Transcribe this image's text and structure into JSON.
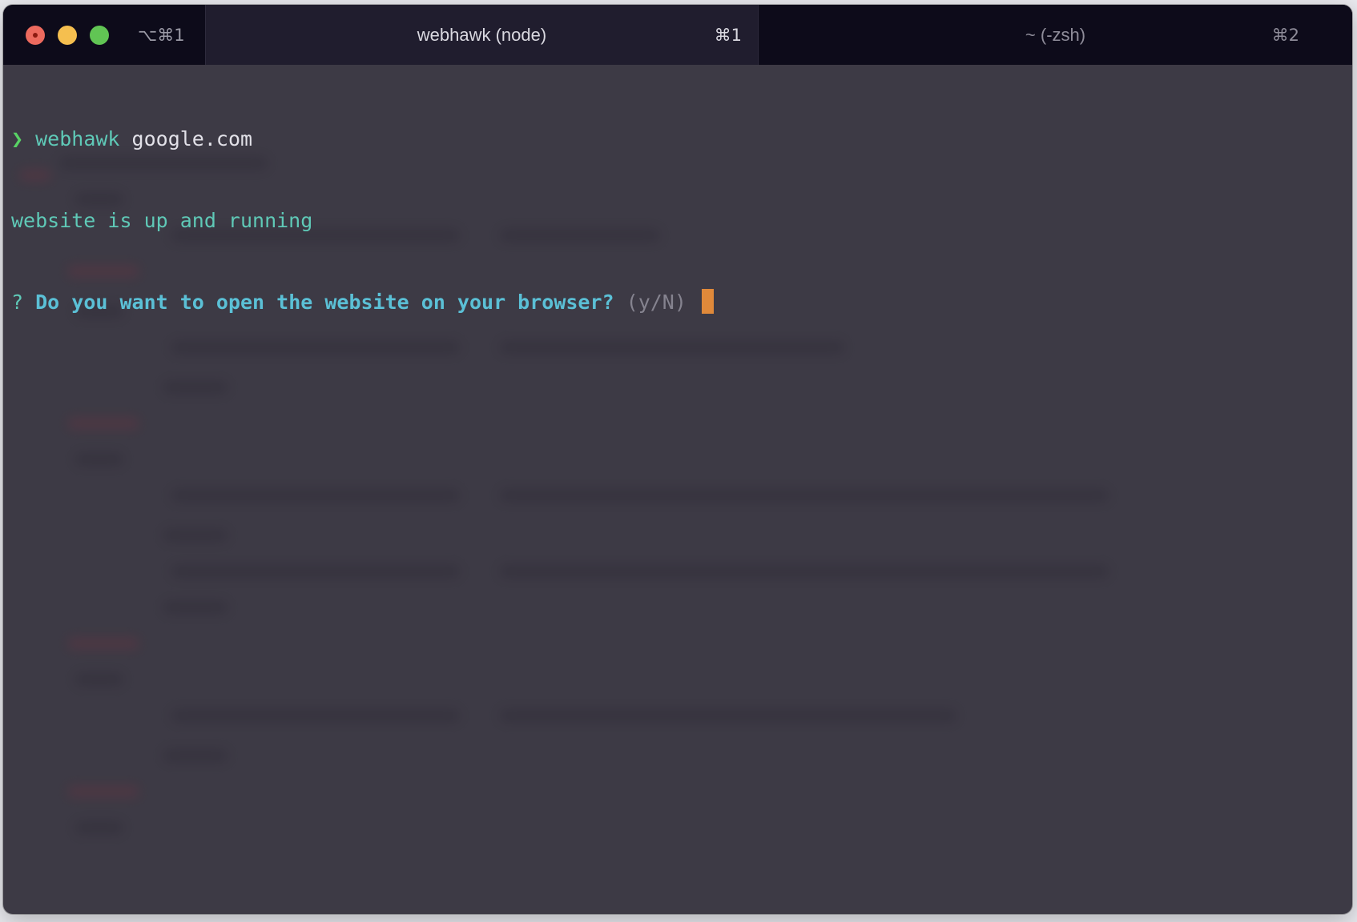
{
  "window": {
    "left_shortcut": "⌥⌘1"
  },
  "tabs": [
    {
      "title": "webhawk (node)",
      "shortcut": "⌘1",
      "active": true
    },
    {
      "title": "~ (-zsh)",
      "shortcut": "⌘2",
      "active": false
    }
  ],
  "terminal": {
    "prompt_symbol": "❯",
    "command_name": "webhawk",
    "command_arg": "google.com",
    "output_line": "website is up and running",
    "question_mark": "?",
    "question_text": "Do you want to open the website on your browser?",
    "question_hint": "(y/N)"
  },
  "colors": {
    "background": "#3d3a45",
    "titlebar": "#0d0b1a",
    "active_tab": "#201d2e",
    "prompt_green": "#58d265",
    "teal": "#5fc9b7",
    "question_cyan": "#5bc0d6",
    "cursor_orange": "#e0893a"
  }
}
